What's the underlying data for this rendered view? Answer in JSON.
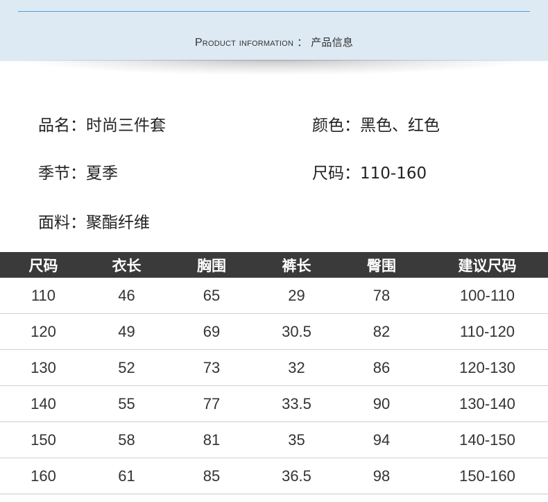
{
  "header": {
    "title_en": "Product information",
    "title_sep": "：",
    "title_cn": "产品信息"
  },
  "info": {
    "name": "品名：时尚三件套",
    "color": "颜色：黑色、红色",
    "season": "季节：夏季",
    "size": "尺码：110-160",
    "material": "面料：聚酯纤维"
  },
  "table": {
    "headers": [
      "尺码",
      "衣长",
      "胸围",
      "裤长",
      "臀围",
      "建议尺码"
    ],
    "rows": [
      [
        "110",
        "46",
        "65",
        "29",
        "78",
        "100-110"
      ],
      [
        "120",
        "49",
        "69",
        "30.5",
        "82",
        "110-120"
      ],
      [
        "130",
        "52",
        "73",
        "32",
        "86",
        "120-130"
      ],
      [
        "140",
        "55",
        "77",
        "33.5",
        "90",
        "130-140"
      ],
      [
        "150",
        "58",
        "81",
        "35",
        "94",
        "140-150"
      ],
      [
        "160",
        "61",
        "85",
        "36.5",
        "98",
        "150-160"
      ]
    ]
  },
  "colors": {
    "header_bg": "#dde9f3",
    "header_rule": "#4aa3d6",
    "table_header_bg": "#3a3a3a"
  }
}
